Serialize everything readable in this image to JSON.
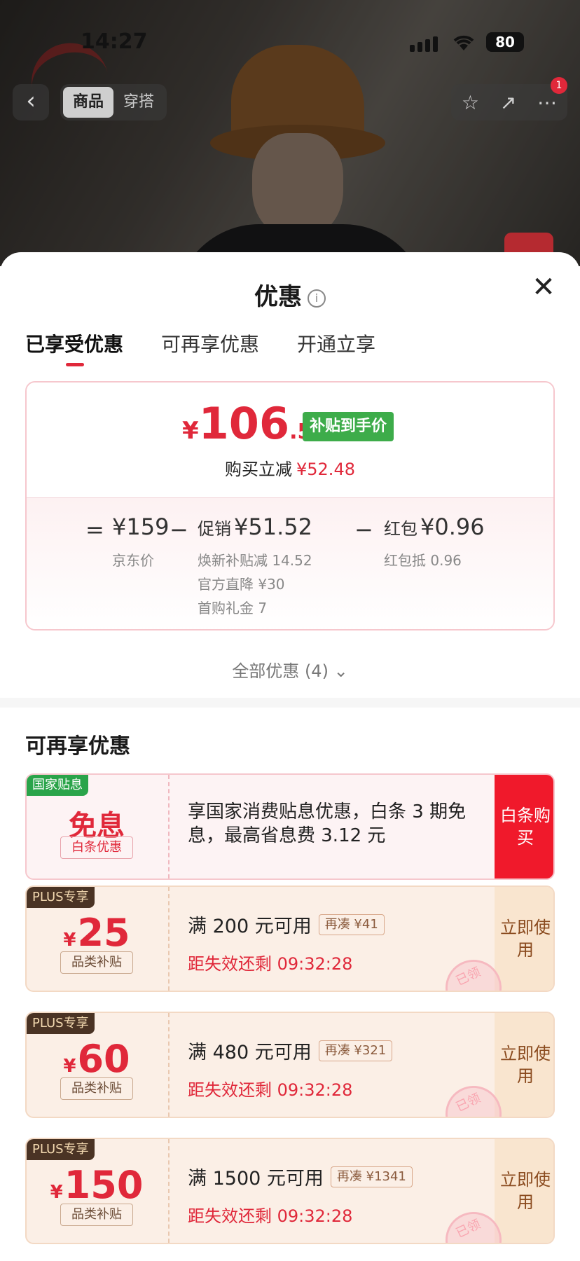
{
  "status": {
    "time": "14:27",
    "battery": "80"
  },
  "nav": {
    "tabs": [
      "商品",
      "穿搭"
    ],
    "badge": "1"
  },
  "sheet": {
    "title": "优惠",
    "tabs": [
      "已享受优惠",
      "可再享优惠",
      "开通立享"
    ]
  },
  "price": {
    "currency": "¥",
    "integer": "106",
    "decimal": ".52",
    "badge": "补贴到手价",
    "cut_label": "购买立减",
    "cut_value": "¥52.48"
  },
  "breakdown": {
    "eq": "=",
    "minus": "−",
    "jd_price": "¥159",
    "jd_label": "京东价",
    "promo_label": "促销",
    "promo_value": "¥51.52",
    "promo_items": [
      "焕新补贴减 14.52",
      "官方直降 ¥30",
      "首购礼金 7"
    ],
    "redpacket_label": "红包",
    "redpacket_value": "¥0.96",
    "redpacket_sub": "红包抵 0.96"
  },
  "all_coupons": "全部优惠 (4)",
  "section_title": "可再享优惠",
  "gov": {
    "tag": "国家贴息",
    "big": "免息",
    "small": "白条优惠",
    "desc": "享国家消费贴息优惠，白条 3 期免息，最高省息费 3.12 元",
    "action": "白条购买"
  },
  "coupons": [
    {
      "tag": "PLUS专享",
      "currency": "¥",
      "amount": "25",
      "category": "品类补贴",
      "condition": "满 200 元可用",
      "more": "再凑 ¥41",
      "countdown": "距失效还剩 09:32:28",
      "action": "立即使用",
      "stamp": "已领"
    },
    {
      "tag": "PLUS专享",
      "currency": "¥",
      "amount": "60",
      "category": "品类补贴",
      "condition": "满 480 元可用",
      "more": "再凑 ¥321",
      "countdown": "距失效还剩 09:32:28",
      "action": "立即使用",
      "stamp": "已领"
    },
    {
      "tag": "PLUS专享",
      "currency": "¥",
      "amount": "150",
      "category": "品类补贴",
      "condition": "满 1500 元可用",
      "more": "再凑 ¥1341",
      "countdown": "距失效还剩 09:32:28",
      "action": "立即使用",
      "stamp": "已领"
    }
  ]
}
